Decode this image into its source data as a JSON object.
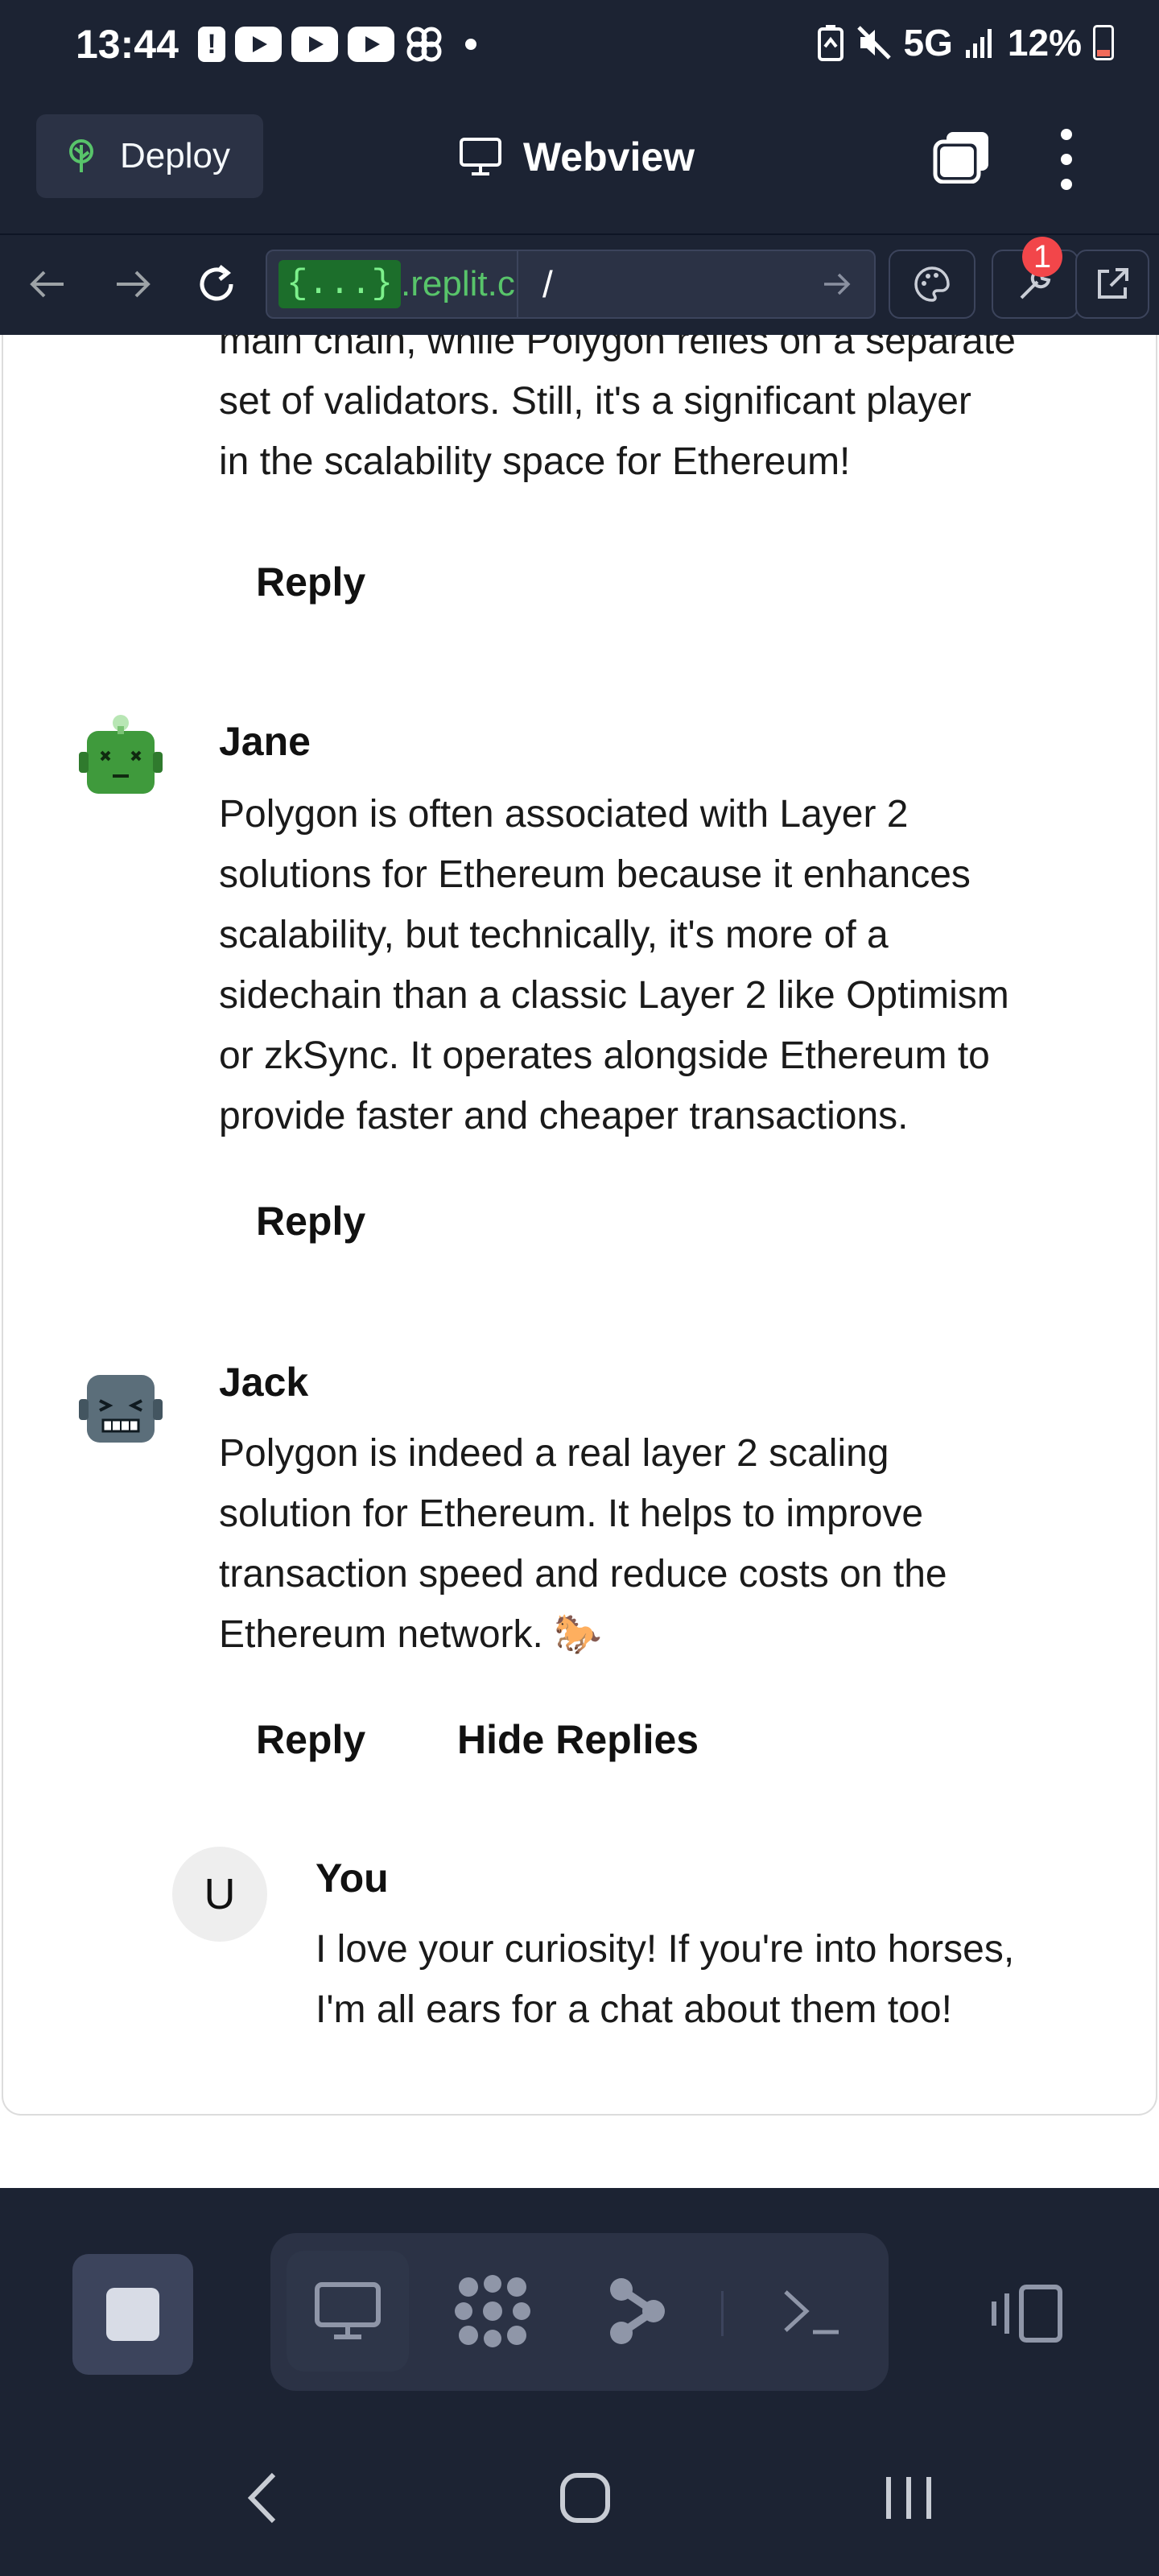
{
  "status_bar": {
    "time": "13:44",
    "network": "5G",
    "battery": "12%",
    "icons": [
      "alert-icon",
      "youtube-icon",
      "youtube-icon",
      "youtube-icon",
      "pinwheel-icon",
      "dot-icon",
      "recycle-battery-icon",
      "mute-icon",
      "signal-icon",
      "battery-icon"
    ]
  },
  "header": {
    "deploy_label": "Deploy",
    "title": "Webview"
  },
  "url_bar": {
    "domain_prefix": "{...}",
    "domain_rest": ".replit.c",
    "path": "/",
    "badge_count": "1"
  },
  "thread": {
    "top_fragment": {
      "lines": [
        "main chain, while Polygon relies on a separate",
        "set of validators. Still, it's a significant player",
        "in the scalability space for Ethereum!"
      ],
      "reply_label": "Reply"
    },
    "comments": [
      {
        "author": "Jane",
        "lines": [
          "Polygon is often associated with Layer 2",
          "solutions for Ethereum because it enhances",
          "scalability, but technically, it's more of a",
          "sidechain than a classic Layer 2 like Optimism",
          "or zkSync. It operates alongside Ethereum to",
          "provide faster and cheaper transactions."
        ],
        "reply_label": "Reply"
      },
      {
        "author": "Jack",
        "lines": [
          "Polygon is indeed a real layer 2 scaling",
          "solution for Ethereum. It helps to improve",
          "transaction speed and reduce costs on the",
          "Ethereum network. 🐎"
        ],
        "reply_label": "Reply",
        "hide_replies_label": "Hide Replies"
      }
    ],
    "nested_reply": {
      "avatar_letter": "U",
      "author": "You",
      "lines": [
        "I love your curiosity! If you're into horses,",
        "I'm all ears for a chat about them too!"
      ]
    }
  },
  "colors": {
    "dark_bg": "#1c2333",
    "panel": "#2b3245",
    "accent_green": "#58c46a",
    "badge_red": "#f2464a"
  }
}
